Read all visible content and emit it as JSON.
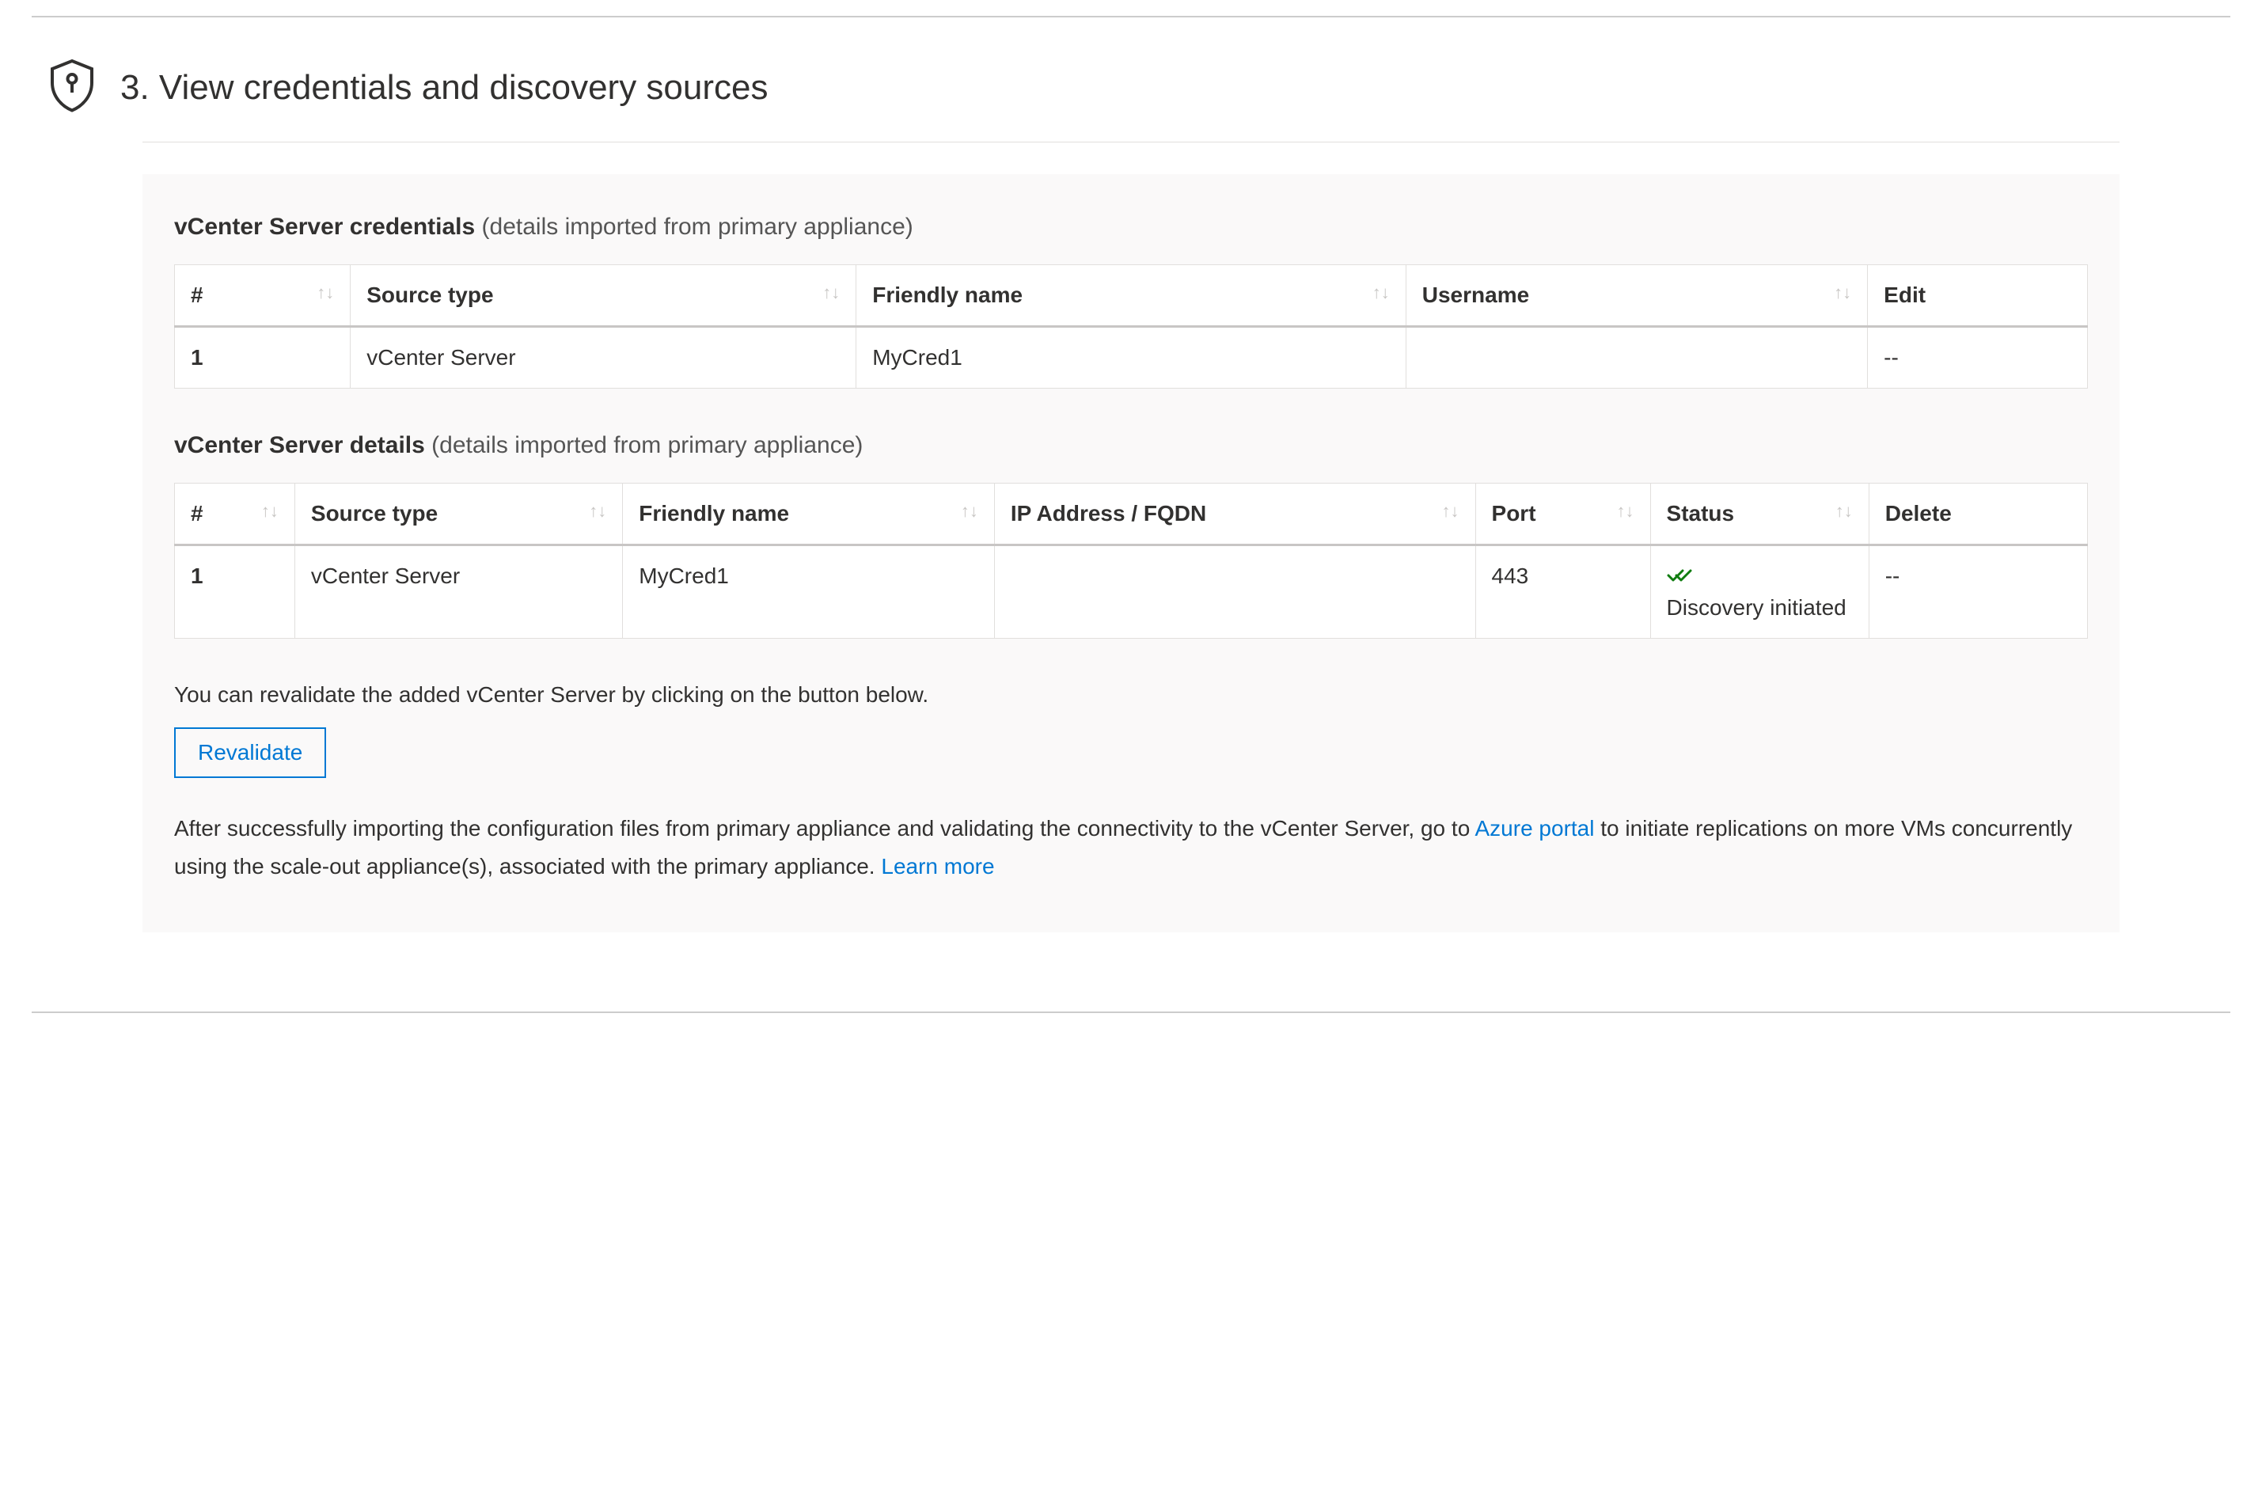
{
  "section": {
    "title": "3. View credentials and discovery sources"
  },
  "credentials": {
    "heading_bold": "vCenter Server credentials",
    "heading_muted": " (details imported from primary appliance)",
    "columns": {
      "num": "#",
      "source_type": "Source type",
      "friendly_name": "Friendly name",
      "username": "Username",
      "edit": "Edit"
    },
    "rows": [
      {
        "num": "1",
        "source_type": "vCenter Server",
        "friendly_name": "MyCred1",
        "username": "",
        "edit": "--"
      }
    ]
  },
  "details": {
    "heading_bold": "vCenter Server details",
    "heading_muted": " (details imported from primary appliance)",
    "columns": {
      "num": "#",
      "source_type": "Source type",
      "friendly_name": "Friendly name",
      "ip": "IP Address / FQDN",
      "port": "Port",
      "status": "Status",
      "delete": "Delete"
    },
    "rows": [
      {
        "num": "1",
        "source_type": "vCenter Server",
        "friendly_name": "MyCred1",
        "ip": "",
        "port": "443",
        "status_text": "Discovery initiated",
        "delete": "--"
      }
    ]
  },
  "help": {
    "revalidate_text": "You can revalidate the added vCenter Server by clicking on the button below.",
    "revalidate_button": "Revalidate",
    "footer_prefix": "After successfully importing the configuration files from primary appliance and validating the connectivity to the vCenter Server, go to ",
    "footer_link1": "Azure portal",
    "footer_middle": " to initiate replications on more VMs concurrently using the scale-out appliance(s), associated with the primary appliance. ",
    "footer_link2": "Learn more"
  },
  "sort_glyph": "↑↓"
}
